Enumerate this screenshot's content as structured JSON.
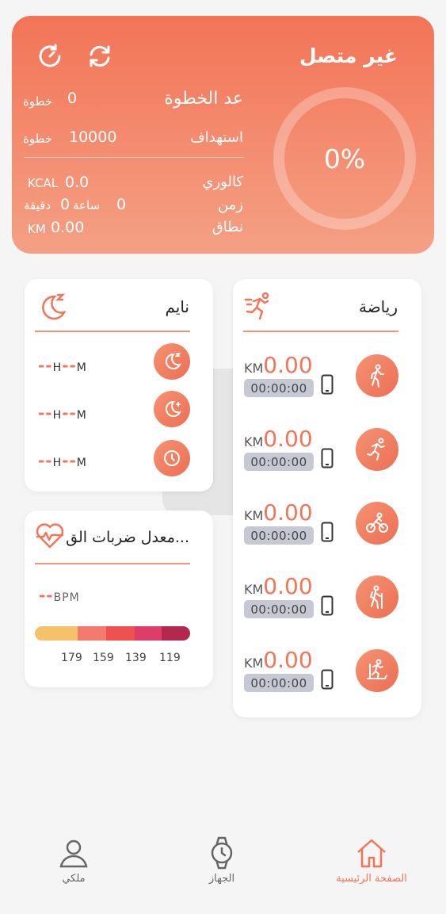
{
  "header": {
    "title": "غير متصل",
    "progress_text": "0%",
    "steps_label": "عد الخطوة",
    "steps_value": "0",
    "steps_unit": "خطوة",
    "goal_label": "استهداف",
    "goal_value": "10000",
    "goal_unit": "خطوة",
    "calorie_label": "كالوري",
    "calorie_unit": "KCAL",
    "calorie_value": "0.0",
    "time_label": "زمن",
    "time_hours": "0",
    "time_hour_unit": "ساعة",
    "time_minutes": "0",
    "time_minute_unit": "دقيقة",
    "distance_label": "نطاق",
    "distance_unit": "KM",
    "distance_value": "0.00"
  },
  "sleep": {
    "title": "نايم",
    "rows": [
      {
        "dash_h": "--",
        "h": "H",
        "dash_m": "--",
        "m": "M"
      },
      {
        "dash_h": "--",
        "h": "H",
        "dash_m": "--",
        "m": "M"
      },
      {
        "dash_h": "--",
        "h": "H",
        "dash_m": "--",
        "m": "M"
      }
    ]
  },
  "heart": {
    "title": "معدل ضربات الق...",
    "dash": "--",
    "unit": "BPM",
    "scale": [
      "179",
      "159",
      "139",
      "119"
    ],
    "colors": [
      "#f5c26b",
      "#f47a6e",
      "#ee5150",
      "#de3d6a",
      "#b3284e"
    ]
  },
  "sport": {
    "title": "رياضة",
    "rows": [
      {
        "unit": "KM",
        "value": "0.00",
        "time": "00:00:00",
        "icon": "walking-icon"
      },
      {
        "unit": "KM",
        "value": "0.00",
        "time": "00:00:00",
        "icon": "running-icon"
      },
      {
        "unit": "KM",
        "value": "0.00",
        "time": "00:00:00",
        "icon": "cycling-icon"
      },
      {
        "unit": "KM",
        "value": "0.00",
        "time": "00:00:00",
        "icon": "hiking-icon"
      },
      {
        "unit": "KM",
        "value": "0.00",
        "time": "00:00:00",
        "icon": "treadmill-icon"
      }
    ]
  },
  "nav": {
    "home": "الصفحة الرئيسية",
    "device": "الجهاز",
    "profile": "ملكي"
  },
  "colors": {
    "accent": "#f37457",
    "accent_light": "#f4a084"
  }
}
